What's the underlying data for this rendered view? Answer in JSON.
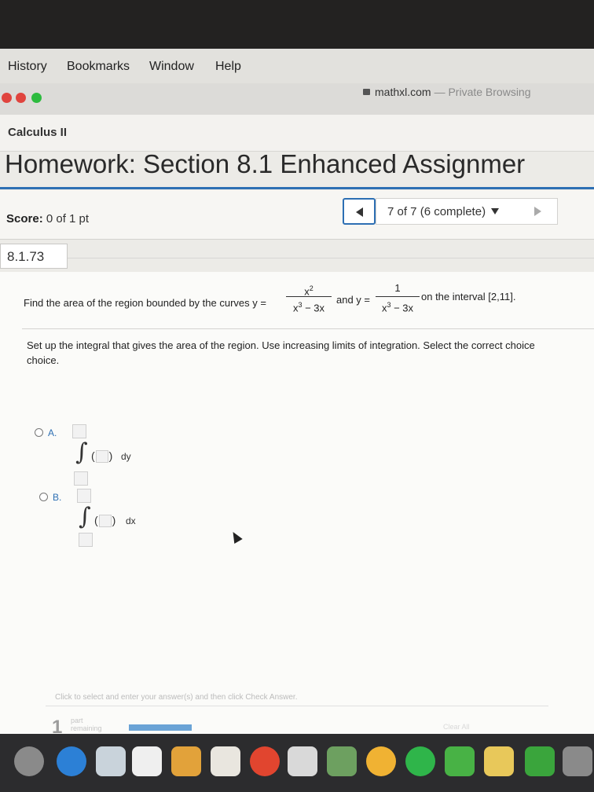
{
  "menubar": {
    "items": [
      "History",
      "Bookmarks",
      "Window",
      "Help"
    ]
  },
  "browser": {
    "url": "mathxl.com",
    "mode": "— Private Browsing",
    "traffic_colors": [
      "#e0443e",
      "#e0443e",
      "#2dbb3f"
    ]
  },
  "course": "Calculus II",
  "homework_title": "Homework: Section 8.1 Enhanced Assignmer",
  "score": {
    "label": "Score:",
    "value": "0 of 1 pt"
  },
  "nav": {
    "position": "7 of 7 (6 complete)"
  },
  "question": {
    "number": "8.1.73",
    "prompt_start": "Find the area of the region bounded by the curves y =",
    "frac1": {
      "num": "x",
      "num_exp": "2",
      "den": "x",
      "den_exp": "3",
      "den_rest": " − 3x"
    },
    "and_text": "and y =",
    "frac2": {
      "num": "1",
      "den": "x",
      "den_exp": "3",
      "den_rest": " − 3x"
    },
    "interval": "on the interval [2,11].",
    "setup_line1": "Set up the integral that gives the area of the region. Use increasing limits of integration. Select the correct choice",
    "setup_line2": "choice."
  },
  "options": [
    {
      "label": "A.",
      "var": "dy"
    },
    {
      "label": "B.",
      "var": "dx"
    }
  ],
  "footer": {
    "instruction": "Click to select and enter your answer(s) and then click Check Answer.",
    "parts_count": "1",
    "parts_label_1": "part",
    "parts_label_2": "remaining",
    "clear_label": "Clear All",
    "progress": 0.5
  },
  "colors": {
    "accent": "#2d6fb3"
  }
}
